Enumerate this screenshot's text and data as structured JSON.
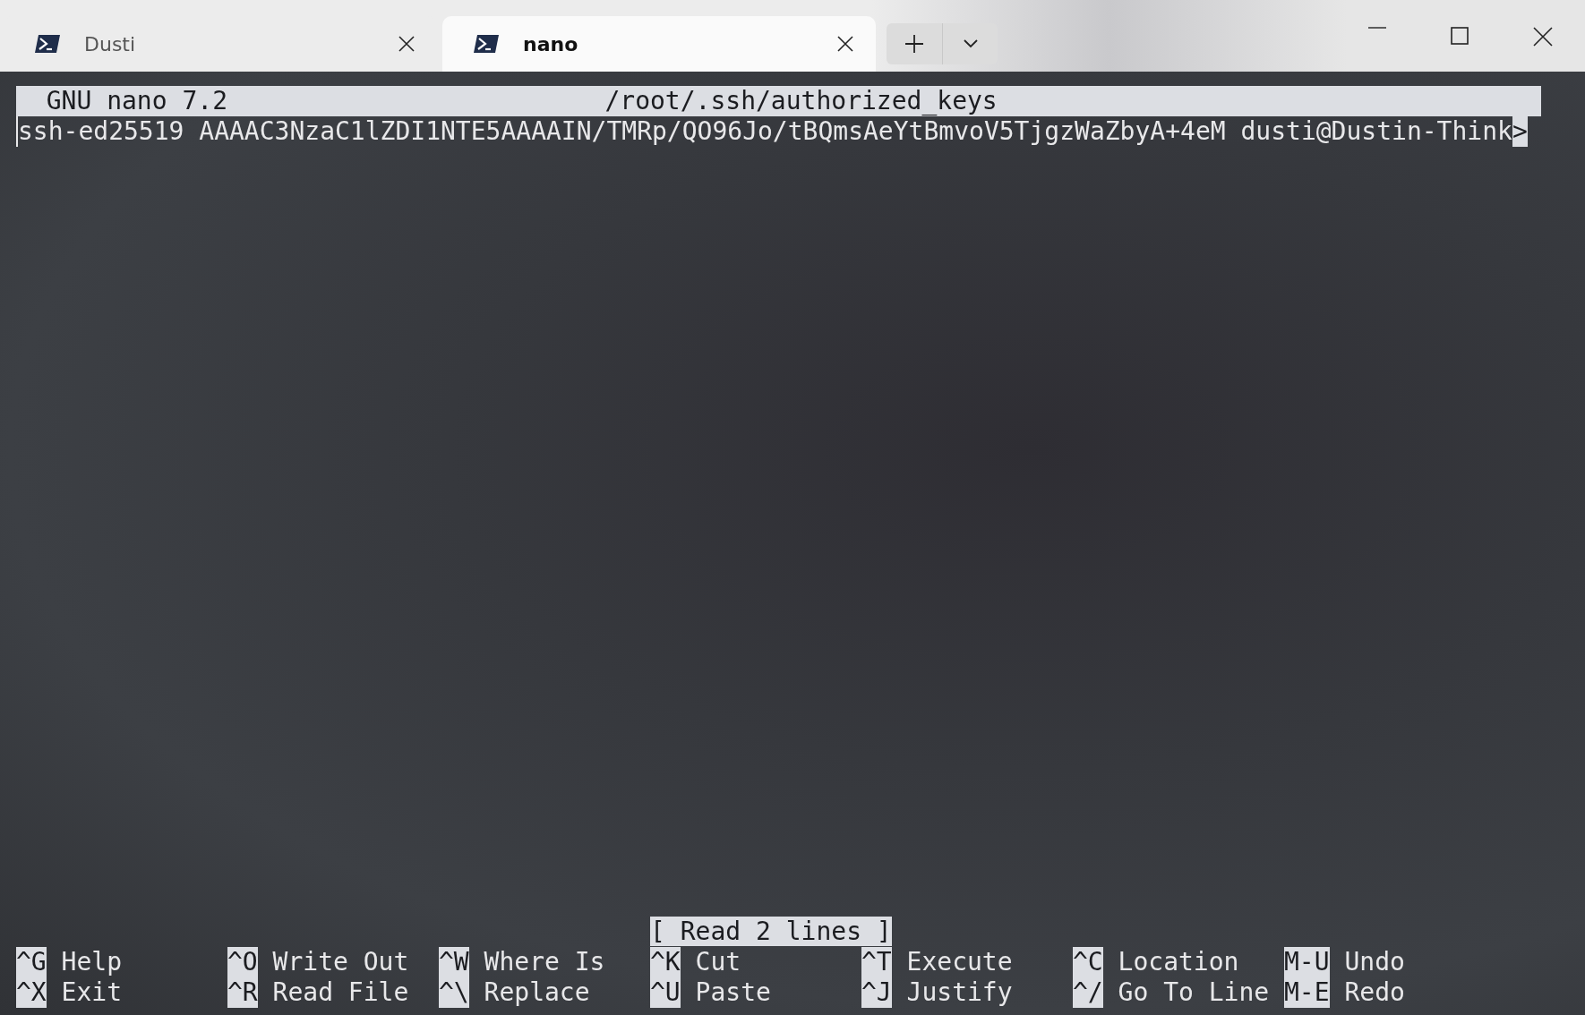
{
  "tabs": [
    {
      "title": "Dusti",
      "selected": false
    },
    {
      "title": "nano",
      "selected": true
    }
  ],
  "editor": {
    "title_bar": {
      "version": "GNU nano 7.2",
      "file": "/root/.ssh/authorized_keys"
    },
    "lines": [
      {
        "text": "ssh-ed25519 AAAAC3NzaC1lZDI1NTE5AAAAIN/TMRp/QO96Jo/tBQmsAeYtBmvoV5TjgzWaZbyA+4eM dusti@Dustin-Think",
        "overflow_mark": ">"
      }
    ],
    "status": "[ Read 2 lines ]",
    "shortcuts": [
      [
        {
          "key": "^G",
          "label": "Help"
        },
        {
          "key": "^O",
          "label": "Write Out"
        },
        {
          "key": "^W",
          "label": "Where Is"
        },
        {
          "key": "^K",
          "label": "Cut"
        },
        {
          "key": "^T",
          "label": "Execute"
        },
        {
          "key": "^C",
          "label": "Location"
        },
        {
          "key": "M-U",
          "label": "Undo"
        }
      ],
      [
        {
          "key": "^X",
          "label": "Exit"
        },
        {
          "key": "^R",
          "label": "Read File"
        },
        {
          "key": "^\\",
          "label": "Replace"
        },
        {
          "key": "^U",
          "label": "Paste"
        },
        {
          "key": "^J",
          "label": "Justify"
        },
        {
          "key": "^/",
          "label": "Go To Line"
        },
        {
          "key": "M-E",
          "label": "Redo"
        }
      ]
    ]
  }
}
